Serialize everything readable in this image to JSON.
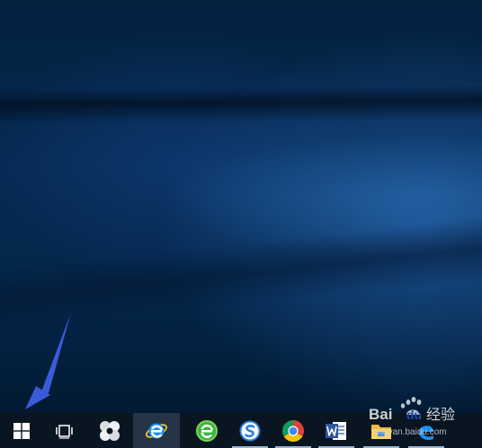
{
  "taskbar": {
    "items": [
      {
        "name": "start-button",
        "icon": "windows-logo-icon"
      },
      {
        "name": "task-view-button",
        "icon": "task-view-icon"
      },
      {
        "name": "pinwheel-app-button",
        "icon": "pinwheel-icon"
      },
      {
        "name": "internet-explorer-button",
        "icon": "internet-explorer-icon"
      },
      {
        "name": "green-browser-button",
        "icon": "green-e-browser-icon"
      },
      {
        "name": "sogou-browser-button",
        "icon": "sogou-s-icon"
      },
      {
        "name": "chrome-button",
        "icon": "chrome-icon"
      },
      {
        "name": "word-button",
        "icon": "word-icon"
      },
      {
        "name": "file-explorer-button",
        "icon": "folder-icon"
      },
      {
        "name": "edge-button",
        "icon": "edge-icon"
      }
    ],
    "background": "#0a1522",
    "active_background": "#253446"
  },
  "annotation": {
    "arrow_color": "#3a5bd9"
  },
  "watermark": {
    "logo_text": "Bai du 经验",
    "url": "jingyan.baidu.com"
  }
}
